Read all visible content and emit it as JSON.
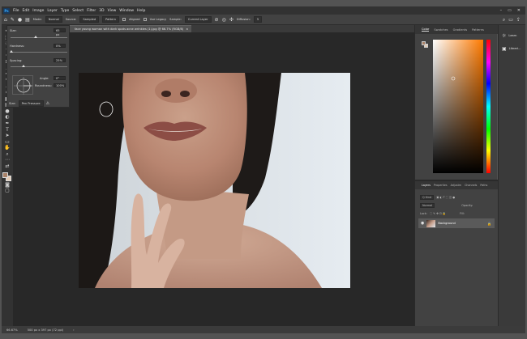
{
  "app": {
    "logo": "Ps"
  },
  "menu": [
    "File",
    "Edit",
    "Image",
    "Layer",
    "Type",
    "Select",
    "Filter",
    "3D",
    "View",
    "Window",
    "Help"
  ],
  "window_controls": [
    "–",
    "▭",
    "✕"
  ],
  "options_bar": {
    "mode_label": "Mode:",
    "mode_value": "Normal",
    "source_label": "Source:",
    "source_sampled": "Sampled",
    "source_pattern": "Pattern",
    "aligned_label": "Aligned",
    "use_legacy_label": "Use Legacy",
    "sample_label": "Sample:",
    "sample_value": "Current Layer",
    "diffusion_label": "Diffusion:",
    "diffusion_value": "5"
  },
  "brush_panel": {
    "size_label": "Size:",
    "size_value": "65 px",
    "hardness_label": "Hardness:",
    "hardness_value": "0%",
    "spacing_label": "Spacing:",
    "spacing_value": "25%",
    "angle_label": "Angle:",
    "angle_value": "0°",
    "roundness_label": "Roundness:",
    "roundness_value": "100%",
    "preset_label": "Size:",
    "preset_value": "Pen Pressure"
  },
  "document": {
    "tab_title": "face young woman with dark spots acne wrinkles (1).jpg @ 66.7% (RGB/8)",
    "close": "×"
  },
  "status": {
    "zoom": "66.67%",
    "dimensions": "500 px x 397 px (72 ppi)",
    "arrow": "›"
  },
  "color_panel": {
    "tabs": [
      "Color",
      "Swatches",
      "Gradients",
      "Patterns"
    ],
    "active": "Color"
  },
  "layers_panel": {
    "tabs": [
      "Layers",
      "Properties",
      "Adjustm",
      "Channels",
      "Paths"
    ],
    "active": "Layers",
    "kind_label": "Q Kind",
    "blend_label": "Normal",
    "opacity_label": "Opacity:",
    "lock_label": "Lock:",
    "fill_label": "Fill:",
    "layer_name": "Background"
  },
  "far_right": [
    {
      "icon": "lightbulb-icon",
      "glyph": "☼",
      "label": "Learn"
    },
    {
      "icon": "libraries-icon",
      "glyph": "▣",
      "label": "Librari..."
    }
  ],
  "colors": {
    "foreground": "#a98268",
    "background": "#e3cab4"
  }
}
